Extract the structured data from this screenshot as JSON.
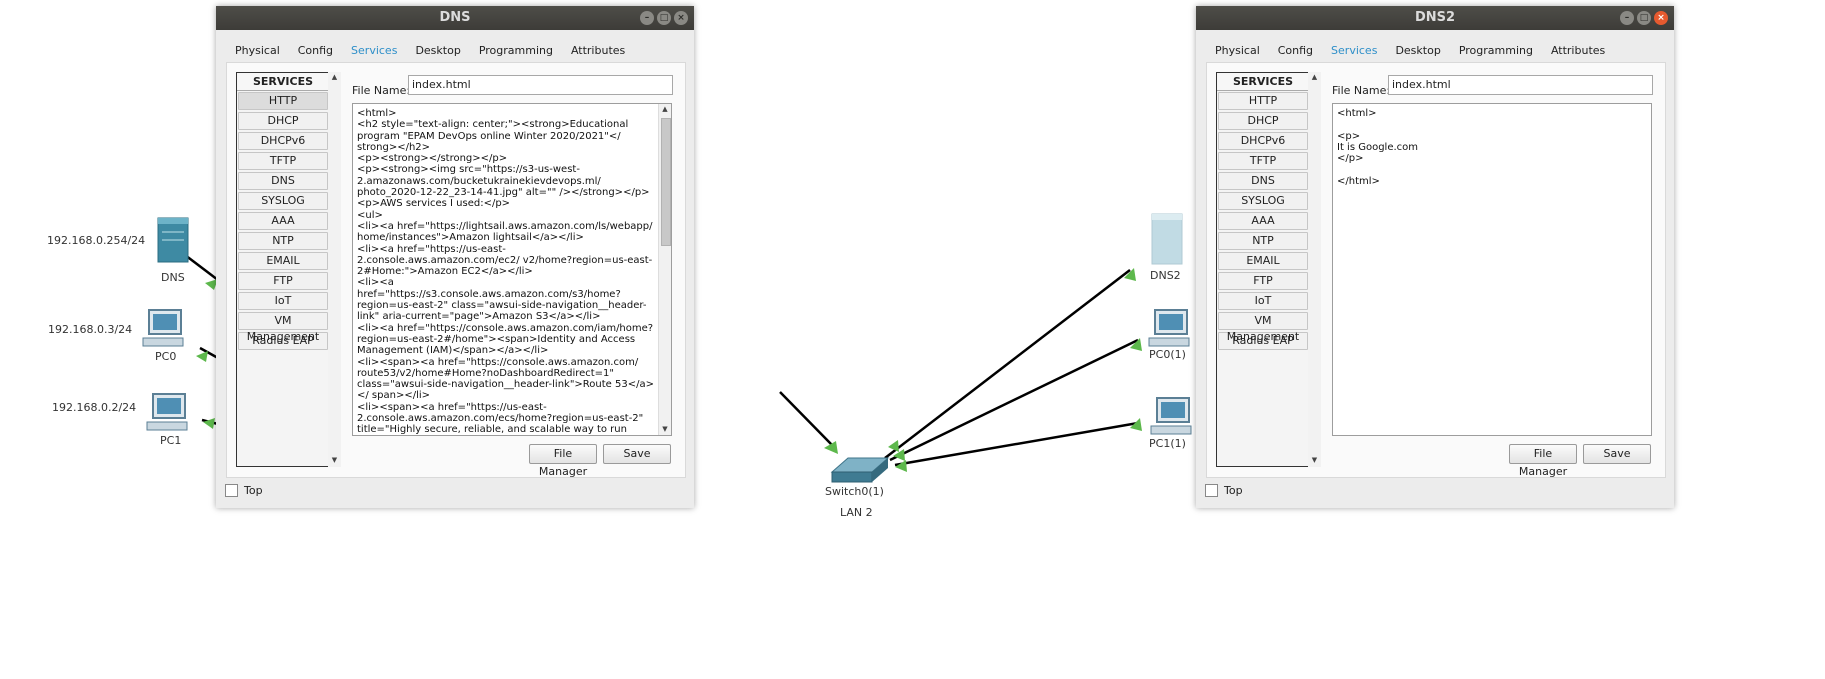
{
  "topology": {
    "devices": [
      {
        "id": "dns",
        "name": "DNS",
        "ip": "192.168.0.254/24",
        "type": "server"
      },
      {
        "id": "pc0",
        "name": "PC0",
        "ip": "192.168.0.3/24",
        "type": "pc"
      },
      {
        "id": "pc1",
        "name": "PC1",
        "ip": "192.168.0.2/24",
        "type": "pc"
      },
      {
        "id": "switch",
        "name": "Switch0(1)",
        "sub": "LAN 2",
        "type": "switch"
      },
      {
        "id": "dns2",
        "name": "DNS2",
        "type": "server"
      },
      {
        "id": "pc0_1",
        "name": "PC0(1)",
        "type": "pc"
      },
      {
        "id": "pc1_1",
        "name": "PC1(1)",
        "type": "pc"
      }
    ],
    "link_color": "#000000",
    "link_status_color": "#5db84c"
  },
  "windows": [
    {
      "title": "DNS",
      "tabs": [
        "Physical",
        "Config",
        "Services",
        "Desktop",
        "Programming",
        "Attributes"
      ],
      "active_tab": "Services",
      "services_header": "SERVICES",
      "services": [
        "HTTP",
        "DHCP",
        "DHCPv6",
        "TFTP",
        "DNS",
        "SYSLOG",
        "AAA",
        "NTP",
        "EMAIL",
        "FTP",
        "IoT",
        "VM Management",
        "Radius EAP"
      ],
      "selected_service": "HTTP",
      "file_name_label": "File Name:",
      "file_name": "index.html",
      "content": "<html>\n<h2 style=\"text-align: center;\"><strong>Educational program \"EPAM DevOps online Winter 2020/2021\"</ strong></h2>\n<p><strong></strong></p>\n<p><strong><img src=\"https://s3-us-west-2.amazonaws.com/bucketukrainekievdevops.ml/ photo_2020-12-22_23-14-41.jpg\" alt=\"\" /></strong></p>\n<p>AWS services I used:</p>\n<ul>\n<li><a href=\"https://lightsail.aws.amazon.com/ls/webapp/ home/instances\">Amazon lightsail</a></li>\n<li><a href=\"https://us-east-2.console.aws.amazon.com/ec2/ v2/home?region=us-east-2#Home:\">Amazon EC2</a></li>\n<li><a href=\"https://s3.console.aws.amazon.com/s3/home? region=us-east-2\" class=\"awsui-side-navigation__header-link\" aria-current=\"page\">Amazon S3</a></li>\n<li><a href=\"https://console.aws.amazon.com/iam/home? region=us-east-2#/home\"><span>Identity and Access Management (IAM)</span></a></li>\n<li><span><a href=\"https://console.aws.amazon.com/ route53/v2/home#Home?noDashboardRedirect=1\" class=\"awsui-side-navigation__header-link\">Route 53</a></ span></li>\n<li><span><a href=\"https://us-east-2.console.aws.amazon.com/ecs/home?region=us-east-2\" title=\"Highly secure, reliable, and scalable way to run containers\" target=\"_top\" class=\"_142-PMqGBA2POWIl07OolW\" data-testid=\"ecs\"><span>",
      "file_manager_label": "File Manager",
      "save_label": "Save",
      "top_label": "Top"
    },
    {
      "title": "DNS2",
      "tabs": [
        "Physical",
        "Config",
        "Services",
        "Desktop",
        "Programming",
        "Attributes"
      ],
      "active_tab": "Services",
      "services_header": "SERVICES",
      "services": [
        "HTTP",
        "DHCP",
        "DHCPv6",
        "TFTP",
        "DNS",
        "SYSLOG",
        "AAA",
        "NTP",
        "EMAIL",
        "FTP",
        "IoT",
        "VM Management",
        "Radius EAP"
      ],
      "selected_service": "",
      "file_name_label": "File Name:",
      "file_name": "index.html",
      "content": "<html>\n\n<p>\nIt is Google.com\n</p>\n\n</html>",
      "file_manager_label": "File Manager",
      "save_label": "Save",
      "top_label": "Top"
    }
  ],
  "colors": {
    "tab_active": "#2e8fc9",
    "titlebar": "#3f3e3a",
    "close_button": "#e65a2f"
  }
}
